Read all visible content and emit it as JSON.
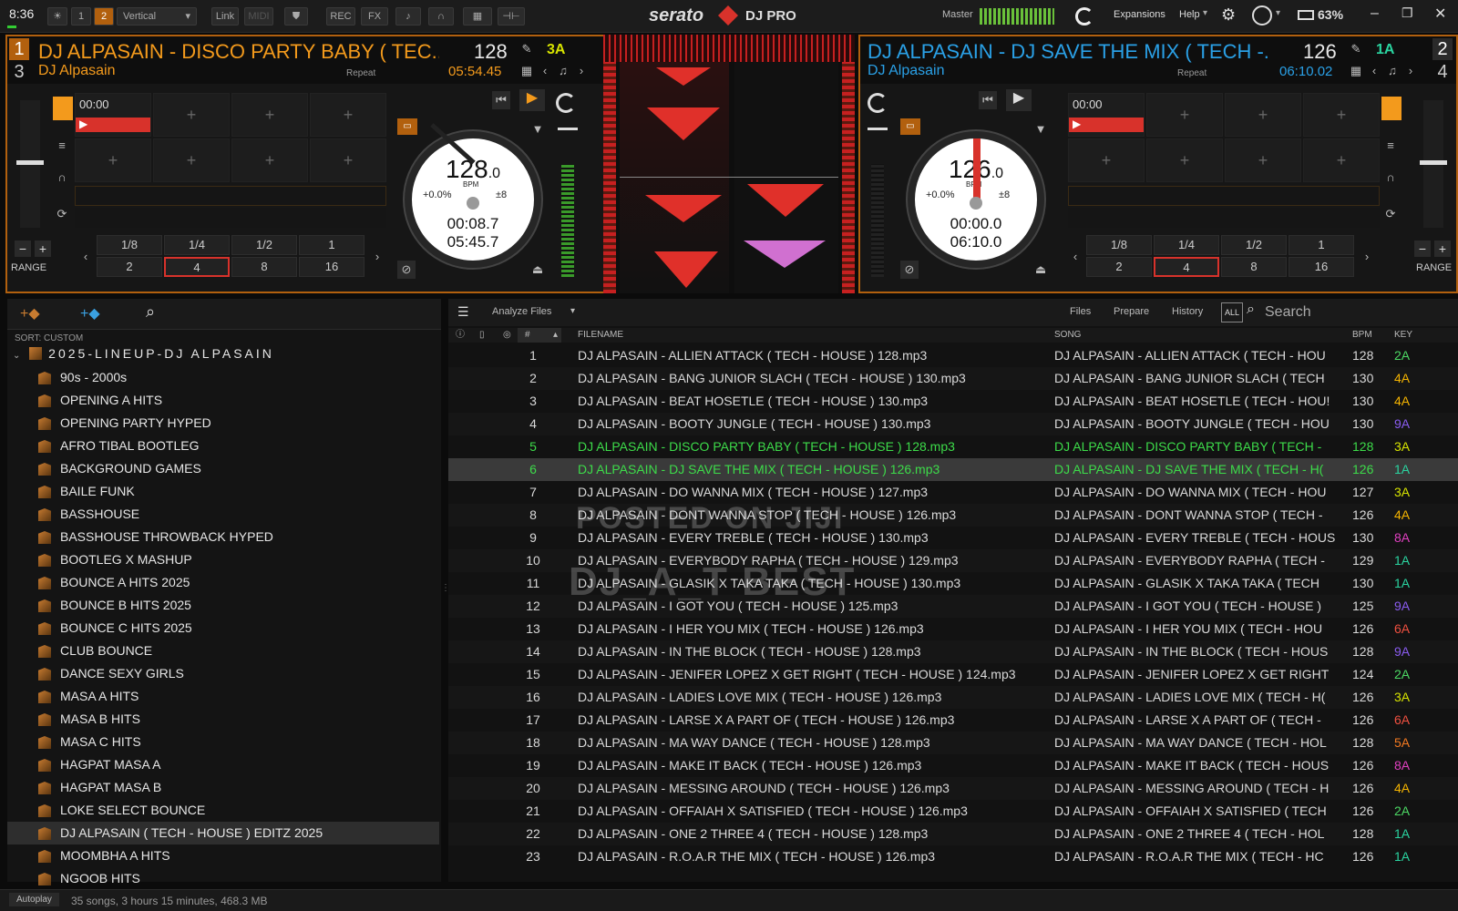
{
  "topbar": {
    "clock": "8:36",
    "layout_btn1": "1",
    "layout_btn2": "2",
    "layout_select": "Vertical",
    "link": "Link",
    "midi": "MIDI",
    "rec": "REC",
    "fx": "FX",
    "logo": "serato",
    "product": "DJ PRO",
    "master": "Master",
    "expansions": "Expansions",
    "help": "Help",
    "battery": "63%",
    "colors": {
      "accent": "#f39a1c",
      "brand_red": "#d8322b",
      "key_yellow": "#d7e400"
    }
  },
  "deck1": {
    "num_top": "1",
    "num_bottom": "3",
    "title": "DJ ALPASAIN - DISCO PARTY BABY ( TEC...",
    "artist": "DJ Alpasain",
    "repeat": "Repeat",
    "bpm": "128",
    "key": "3A",
    "time_remaining": "05:54.45",
    "cue_time": "00:00",
    "platter": {
      "bpm": "128",
      "bpm_dec": ".0",
      "bpm_label": "BPM",
      "pitch": "+0.0%",
      "range": "±8",
      "elapsed": "00:08.7",
      "remaining": "05:45.7"
    },
    "loops_top": [
      "1/8",
      "1/4",
      "1/2",
      "1"
    ],
    "loops_bottom": [
      "2",
      "4",
      "8",
      "16"
    ],
    "range_label": "RANGE"
  },
  "deck2": {
    "num_top": "2",
    "num_bottom": "4",
    "title": "DJ ALPASAIN - DJ SAVE THE MIX ( TECH -...",
    "artist": "DJ Alpasain",
    "repeat": "Repeat",
    "bpm": "126",
    "key": "1A",
    "time_remaining": "06:10.02",
    "cue_time": "00:00",
    "platter": {
      "bpm": "126",
      "bpm_dec": ".0",
      "bpm_label": "BPM",
      "pitch": "+0.0%",
      "range": "±8",
      "elapsed": "00:00.0",
      "remaining": "06:10.0"
    },
    "loops_top": [
      "1/8",
      "1/4",
      "1/2",
      "1"
    ],
    "loops_bottom": [
      "2",
      "4",
      "8",
      "16"
    ],
    "range_label": "RANGE"
  },
  "library": {
    "sort_label": "SORT: CUSTOM",
    "root_crate": "2025-LINEUP-DJ ALPASAIN",
    "crates": [
      "90s - 2000s",
      "OPENING A HITS",
      "OPENING PARTY HYPED",
      "AFRO TIBAL BOOTLEG",
      "BACKGROUND GAMES",
      "BAILE FUNK",
      "BASSHOUSE",
      "BASSHOUSE THROWBACK HYPED",
      "BOOTLEG X MASHUP",
      "BOUNCE A HITS 2025",
      "BOUNCE B HITS 2025",
      "BOUNCE C HITS 2025",
      "CLUB BOUNCE",
      "DANCE SEXY GIRLS",
      "MASA A HITS",
      "MASA B HITS",
      "MASA C HITS",
      "HAGPAT MASA A",
      "HAGPAT MASA B",
      "LOKE SELECT BOUNCE",
      "DJ ALPASAIN ( TECH - HOUSE ) EDITZ 2025",
      "MOOMBHA A HITS",
      "NGOOB HITS"
    ],
    "selected_crate": "DJ ALPASAIN ( TECH - HOUSE ) EDITZ 2025",
    "toolbar": {
      "analyze": "Analyze Files",
      "files": "Files",
      "prepare": "Prepare",
      "history": "History",
      "all": "ALL",
      "search_placeholder": "Search"
    },
    "columns": {
      "num": "#",
      "filename": "FILENAME",
      "song": "SONG",
      "bpm": "BPM",
      "key": "KEY"
    },
    "tracks": [
      {
        "n": "1",
        "file": "DJ ALPASAIN - ALLIEN ATTACK ( TECH - HOUSE ) 128.mp3",
        "song": "DJ ALPASAIN - ALLIEN ATTACK ( TECH - HOU",
        "bpm": "128",
        "key": "2A",
        "kc": "#4cd964"
      },
      {
        "n": "2",
        "file": "DJ ALPASAIN - BANG JUNIOR SLACH ( TECH - HOUSE ) 130.mp3",
        "song": "DJ ALPASAIN - BANG JUNIOR SLACH ( TECH",
        "bpm": "130",
        "key": "4A",
        "kc": "#f5b400"
      },
      {
        "n": "3",
        "file": "DJ ALPASAIN - BEAT HOSETLE ( TECH - HOUSE ) 130.mp3",
        "song": "DJ ALPASAIN - BEAT HOSETLE ( TECH - HOU!",
        "bpm": "130",
        "key": "4A",
        "kc": "#f5b400"
      },
      {
        "n": "4",
        "file": "DJ ALPASAIN - BOOTY JUNGLE ( TECH - HOUSE ) 130.mp3",
        "song": "DJ ALPASAIN - BOOTY JUNGLE ( TECH - HOU",
        "bpm": "130",
        "key": "9A",
        "kc": "#8a5cf0"
      },
      {
        "n": "5",
        "file": "DJ ALPASAIN - DISCO PARTY BABY ( TECH - HOUSE ) 128.mp3",
        "song": "DJ ALPASAIN - DISCO PARTY BABY ( TECH -",
        "bpm": "128",
        "key": "3A",
        "kc": "#d7e400"
      },
      {
        "n": "6",
        "file": "DJ ALPASAIN - DJ SAVE THE MIX ( TECH - HOUSE ) 126.mp3",
        "song": "DJ ALPASAIN - DJ SAVE THE MIX ( TECH - H(",
        "bpm": "126",
        "key": "1A",
        "kc": "#2ad4a0"
      },
      {
        "n": "7",
        "file": "DJ ALPASAIN - DO WANNA MIX ( TECH - HOUSE ) 127.mp3",
        "song": "DJ ALPASAIN - DO WANNA MIX ( TECH - HOU",
        "bpm": "127",
        "key": "3A",
        "kc": "#d7e400"
      },
      {
        "n": "8",
        "file": "DJ ALPASAIN - DONT WANNA STOP ( TECH - HOUSE ) 126.mp3",
        "song": "DJ ALPASAIN - DONT WANNA STOP ( TECH -",
        "bpm": "126",
        "key": "4A",
        "kc": "#f5b400"
      },
      {
        "n": "9",
        "file": "DJ ALPASAIN - EVERY TREBLE ( TECH - HOUSE ) 130.mp3",
        "song": "DJ ALPASAIN - EVERY TREBLE ( TECH - HOUS",
        "bpm": "130",
        "key": "8A",
        "kc": "#e040c0"
      },
      {
        "n": "10",
        "file": "DJ ALPASAIN - EVERYBODY RAPHA  ( TECH - HOUSE ) 129.mp3",
        "song": "DJ ALPASAIN - EVERYBODY RAPHA  ( TECH -",
        "bpm": "129",
        "key": "1A",
        "kc": "#2ad4a0"
      },
      {
        "n": "11",
        "file": "DJ ALPASAIN - GLASIK X TAKA TAKA ( TECH - HOUSE ) 130.mp3",
        "song": "DJ ALPASAIN - GLASIK X TAKA TAKA ( TECH",
        "bpm": "130",
        "key": "1A",
        "kc": "#2ad4a0"
      },
      {
        "n": "12",
        "file": "DJ ALPASAIN - I GOT YOU ( TECH - HOUSE ) 125.mp3",
        "song": "DJ ALPASAIN - I GOT YOU ( TECH - HOUSE )",
        "bpm": "125",
        "key": "9A",
        "kc": "#8a5cf0"
      },
      {
        "n": "13",
        "file": "DJ ALPASAIN - I HER YOU MIX ( TECH - HOUSE ) 126.mp3",
        "song": "DJ ALPASAIN - I HER YOU MIX ( TECH - HOU",
        "bpm": "126",
        "key": "6A",
        "kc": "#f05040"
      },
      {
        "n": "14",
        "file": "DJ ALPASAIN - IN THE BLOCK ( TECH - HOUSE ) 128.mp3",
        "song": "DJ ALPASAIN - IN THE BLOCK ( TECH - HOUS",
        "bpm": "128",
        "key": "9A",
        "kc": "#8a5cf0"
      },
      {
        "n": "15",
        "file": "DJ ALPASAIN - JENIFER LOPEZ X GET RIGHT ( TECH - HOUSE ) 124.mp3",
        "song": "DJ ALPASAIN - JENIFER LOPEZ X GET RIGHT",
        "bpm": "124",
        "key": "2A",
        "kc": "#4cd964"
      },
      {
        "n": "16",
        "file": "DJ ALPASAIN - LADIES LOVE MIX ( TECH - HOUSE ) 126.mp3",
        "song": "DJ ALPASAIN - LADIES LOVE MIX ( TECH - H(",
        "bpm": "126",
        "key": "3A",
        "kc": "#d7e400"
      },
      {
        "n": "17",
        "file": "DJ ALPASAIN - LARSE X A PART OF ( TECH - HOUSE ) 126.mp3",
        "song": "DJ ALPASAIN - LARSE X A PART OF ( TECH -",
        "bpm": "126",
        "key": "6A",
        "kc": "#f05040"
      },
      {
        "n": "18",
        "file": "DJ ALPASAIN - MA WAY DANCE ( TECH - HOUSE ) 128.mp3",
        "song": "DJ ALPASAIN - MA WAY DANCE ( TECH - HOL",
        "bpm": "128",
        "key": "5A",
        "kc": "#f57a20"
      },
      {
        "n": "19",
        "file": "DJ ALPASAIN - MAKE IT BACK ( TECH - HOUSE ) 126.mp3",
        "song": "DJ ALPASAIN - MAKE IT BACK ( TECH - HOUS",
        "bpm": "126",
        "key": "8A",
        "kc": "#e040c0"
      },
      {
        "n": "20",
        "file": "DJ ALPASAIN - MESSING AROUND ( TECH - HOUSE ) 126.mp3",
        "song": "DJ ALPASAIN - MESSING AROUND ( TECH - H",
        "bpm": "126",
        "key": "4A",
        "kc": "#f5b400"
      },
      {
        "n": "21",
        "file": "DJ ALPASAIN - OFFAIAH X SATISFIED ( TECH - HOUSE ) 126.mp3",
        "song": "DJ ALPASAIN - OFFAIAH X SATISFIED ( TECH",
        "bpm": "126",
        "key": "2A",
        "kc": "#4cd964"
      },
      {
        "n": "22",
        "file": "DJ ALPASAIN - ONE 2 THREE 4  ( TECH - HOUSE ) 128.mp3",
        "song": "DJ ALPASAIN - ONE 2 THREE 4  ( TECH - HOL",
        "bpm": "128",
        "key": "1A",
        "kc": "#2ad4a0"
      },
      {
        "n": "23",
        "file": "DJ ALPASAIN - R.O.A.R THE MIX ( TECH - HOUSE ) 126.mp3",
        "song": "DJ ALPASAIN - R.O.A.R THE MIX ( TECH - HC",
        "bpm": "126",
        "key": "1A",
        "kc": "#2ad4a0"
      }
    ],
    "watermark1": "POSTED ON JIJI",
    "watermark2": "DJ_A_T BEST"
  },
  "status": {
    "autoplay": "Autoplay",
    "summary": "35 songs, 3 hours 15 minutes, 468.3 MB"
  }
}
